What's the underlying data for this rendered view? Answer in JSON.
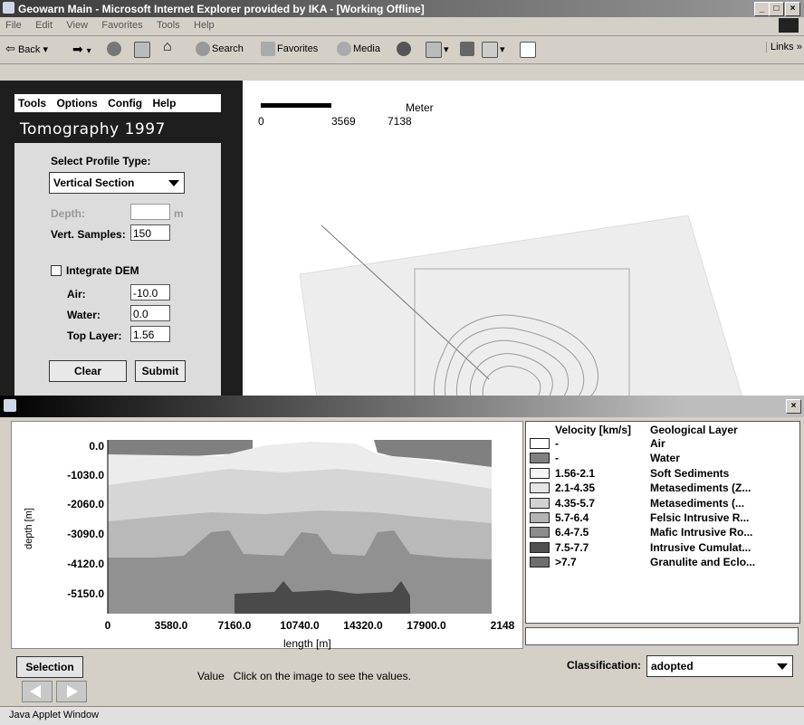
{
  "window": {
    "title": "Geowarn Main - Microsoft Internet Explorer provided by IKA - [Working Offline]",
    "min": "_",
    "max": "□",
    "close": "×"
  },
  "menu": [
    "File",
    "Edit",
    "View",
    "Favorites",
    "Tools",
    "Help"
  ],
  "toolbar": {
    "back": "Back",
    "search": "Search",
    "favorites": "Favorites",
    "media": "Media",
    "links": "Links"
  },
  "app": {
    "menu": [
      "Tools",
      "Options",
      "Config",
      "Help"
    ],
    "title": "Tomography 1997",
    "scale": {
      "unit": "Meter",
      "ticks": [
        "0",
        "3569",
        "7138"
      ]
    }
  },
  "form": {
    "profile_type_label": "Select Profile Type:",
    "profile_type_value": "Vertical Section",
    "depth_label": "Depth:",
    "depth_unit": "m",
    "depth_value": "",
    "vert_samples_label": "Vert. Samples:",
    "vert_samples_value": "150",
    "integrate_dem_label": "Integrate DEM",
    "integrate_dem_checked": false,
    "air_label": "Air:",
    "air_value": "-10.0",
    "water_label": "Water:",
    "water_value": "0.0",
    "top_layer_label": "Top Layer:",
    "top_layer_value": "1.56",
    "clear": "Clear",
    "submit": "Submit"
  },
  "applet": {
    "close": "×",
    "ylabel": "depth [m]",
    "xlabel": "length [m]",
    "yticks": [
      "0.0",
      "-1030.0",
      "-2060.0",
      "-3090.0",
      "-4120.0",
      "-5150.0"
    ],
    "xticks": [
      "0",
      "3580.0",
      "7160.0",
      "10740.0",
      "14320.0",
      "17900.0",
      "2148"
    ],
    "selection": "Selection",
    "value_hint": "Value   Click on the image to see the values.",
    "classification_label": "Classification:",
    "classification_value": "adopted",
    "value_field": ""
  },
  "legend": {
    "col_velocity": "Velocity [km/s]",
    "col_layer": "Geological Layer",
    "rows": [
      {
        "velocity": "-",
        "layer": "Air",
        "color": "#ffffff"
      },
      {
        "velocity": "-",
        "layer": "Water",
        "color": "#808080"
      },
      {
        "velocity": "1.56-2.1",
        "layer": "Soft Sediments",
        "color": "#f6f6f6"
      },
      {
        "velocity": "2.1-4.35",
        "layer": "Metasediments (Z...",
        "color": "#e6e6e6"
      },
      {
        "velocity": "4.35-5.7",
        "layer": "Metasediments (...",
        "color": "#d2d2d2"
      },
      {
        "velocity": "5.7-6.4",
        "layer": "Felsic Intrusive R...",
        "color": "#b4b4b4"
      },
      {
        "velocity": "6.4-7.5",
        "layer": "Mafic Intrusive Ro...",
        "color": "#8c8c8c"
      },
      {
        "velocity": "7.5-7.7",
        "layer": "Intrusive Cumulat...",
        "color": "#505050"
      },
      {
        "velocity": ">7.7",
        "layer": "Granulite and Eclo...",
        "color": "#6e6e6e"
      }
    ]
  },
  "status": "Java Applet Window"
}
